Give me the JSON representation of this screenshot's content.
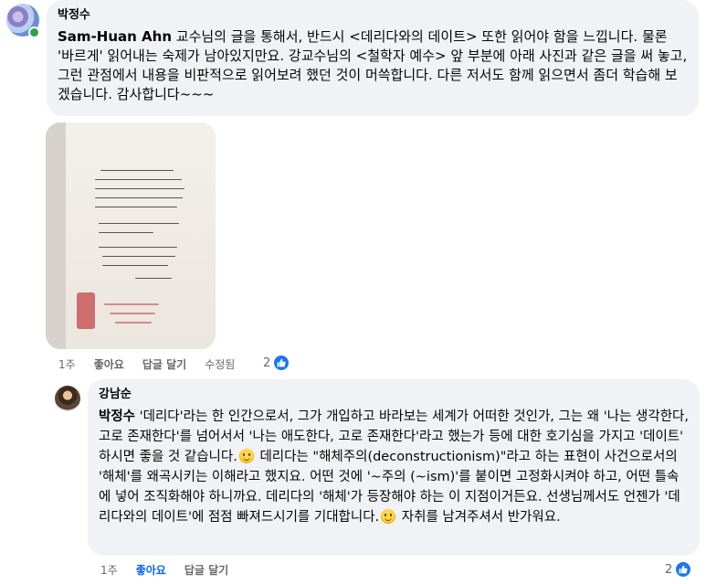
{
  "comment1": {
    "author": "박정수",
    "mention": "Sam-Huan Ahn",
    "text": " 교수님의 글을 통해서, 반드시 <데리다와의 데이트> 또한 읽어야 함을 느낍니다. 물론 '바르게' 읽어내는 숙제가 남아있지만요. 강교수님의 <철학자 예수> 앞 부분에 아래 사진과 같은 글을 써 놓고, 그런 관점에서 내용을 비판적으로 읽어보려 했던 것이 머쓱합니다. 다른 저서도 함께 읽으면서 좀더 학습해 보겠습니다. 감사합니다~~~",
    "time": "1주",
    "like_label": "좋아요",
    "reply_label": "답글 달기",
    "edited_label": "수정됨",
    "reaction_count": "2"
  },
  "comment2": {
    "author": "강남순",
    "mention": "박정수",
    "text_a": " '데리다'라는 한 인간으로서, 그가 개입하고 바라보는 세계가 어떠한 것인가, 그는 왜 '나는 생각한다, 고로 존재한다'를 넘어서서 '나는 애도한다, 고로 존재한다'라고 했는가 등에 대한 호기심을 가지고 '데이트' 하시면 좋을 것 같습니다.",
    "text_b": " 데리다는 \"해체주의(deconstructionism)\"라고 하는 표현이 사건으로서의 '해체'를 왜곡시키는 이해라고 했지요. 어떤 것에 '~주의 (~ism)'를 붙이면 고정화시켜야 하고, 어떤 틀속에 넣어 조직화해야 하니까요. 데리다의 '해체'가 등장해야 하는 이 지점이거든요. 선생님께서도 언젠가 '데리다와의 데이트'에 점점 빠져드시기를 기대합니다.",
    "text_c": " 자취를 남겨주셔서 반가워요.",
    "time": "1주",
    "like_label": "좋아요",
    "reply_label": "답글 달기",
    "reaction_count": "2"
  },
  "icons": {
    "emoji": "smiling-face-emoji",
    "reaction": "like-thumbs-up-icon"
  },
  "colors": {
    "bubble": "#f0f2f5",
    "accent": "#0866ff",
    "meta": "#65676b"
  }
}
